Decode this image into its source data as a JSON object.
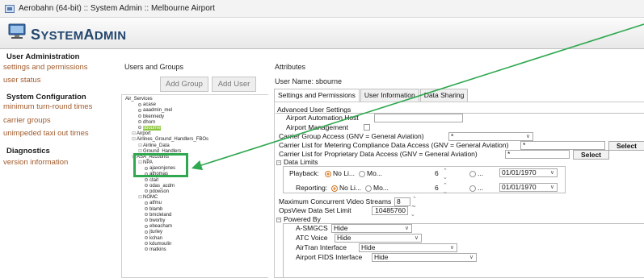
{
  "window": {
    "title": "Aerobahn (64-bit) :: System Admin :: Melbourne Airport"
  },
  "banner": {
    "brand_prefix": "S",
    "brand_main": "YSTEM",
    "brand_prefix2": "A",
    "brand_main2": "DMIN"
  },
  "nav": {
    "sections": [
      {
        "heading": "User Administration",
        "links": [
          "settings and permissions",
          "user status"
        ]
      },
      {
        "heading": "System Configuration",
        "links": [
          "minimum turn-round times",
          "carrier groups",
          "unimpeded taxi out times"
        ]
      },
      {
        "heading": "Diagnostics",
        "links": [
          "version information"
        ]
      }
    ]
  },
  "users_groups": {
    "title": "Users and Groups",
    "add_group": "Add Group",
    "add_user": "Add User",
    "tree": [
      {
        "label": "Air_Services",
        "indent": 0,
        "type": "group"
      },
      {
        "label": "acase",
        "indent": 2,
        "type": "user"
      },
      {
        "label": "aaadmin_mel",
        "indent": 2,
        "type": "user"
      },
      {
        "label": "bkennedy",
        "indent": 2,
        "type": "user"
      },
      {
        "label": "dhorn",
        "indent": 2,
        "type": "user"
      },
      {
        "label": "sbourne",
        "indent": 2,
        "type": "user",
        "selected": true
      },
      {
        "label": "Airport",
        "indent": 1,
        "type": "group"
      },
      {
        "label": "Airlines_Ground_Handlers_FBOs",
        "indent": 1,
        "type": "group"
      },
      {
        "label": "Airline_Data",
        "indent": 2,
        "type": "group"
      },
      {
        "label": "Ground_Handlers",
        "indent": 2,
        "type": "group"
      },
      {
        "label": "ASA_Accounts",
        "indent": 1,
        "type": "group"
      },
      {
        "label": "NPA",
        "indent": 2,
        "type": "group"
      },
      {
        "label": "ajaxonjones",
        "indent": 3,
        "type": "user"
      },
      {
        "label": "athomas",
        "indent": 3,
        "type": "user"
      },
      {
        "label": "ctait",
        "indent": 3,
        "type": "user"
      },
      {
        "label": "odas_acdm",
        "indent": 3,
        "type": "user"
      },
      {
        "label": "pdowson",
        "indent": 3,
        "type": "user"
      },
      {
        "label": "NOMC",
        "indent": 2,
        "type": "group"
      },
      {
        "label": "atfmu",
        "indent": 3,
        "type": "user"
      },
      {
        "label": "blamb",
        "indent": 3,
        "type": "user"
      },
      {
        "label": "bmcleland",
        "indent": 3,
        "type": "user"
      },
      {
        "label": "bworby",
        "indent": 3,
        "type": "user"
      },
      {
        "label": "ebeacham",
        "indent": 3,
        "type": "user"
      },
      {
        "label": "jturley",
        "indent": 3,
        "type": "user"
      },
      {
        "label": "kchan",
        "indent": 3,
        "type": "user"
      },
      {
        "label": "kdumoulin",
        "indent": 3,
        "type": "user"
      },
      {
        "label": "matkins",
        "indent": 3,
        "type": "user"
      }
    ]
  },
  "attributes": {
    "title": "Attributes",
    "user_name": "User Name: sbourne",
    "tabs": [
      "Settings and Permissions",
      "User Information",
      "Data Sharing"
    ],
    "advanced_heading": "Advanced User Settings",
    "host_label": "Airport Automation Host",
    "mgmt_label": "Airport Management",
    "carrier_group_label": "Carrier Group Access (GNV = General Aviation)",
    "carrier_group_value": "*",
    "metering_label": "Carrier List for Metering Compliance Data Access (GNV = General Aviation)",
    "metering_value": "*",
    "proprietary_label": "Carrier List for Proprietary Data Access (GNV = General Aviation)",
    "proprietary_value": "*",
    "select_label": "Select",
    "data_limits": "Data Limits",
    "playback_label": "Playback:",
    "reporting_label": "Reporting:",
    "no_limit": "No Li...",
    "months": "Mo...",
    "months_value": "6",
    "ellipsis": "...",
    "date_value": "01/01/1970",
    "max_streams_label": "Maximum Concurrent Video Streams",
    "max_streams_value": "8",
    "opsview_label": "OpsView Data Set Limit",
    "opsview_value": "10485760",
    "powered_by": "Powered By",
    "asmgcs_label": "A-SMGCS",
    "atc_label": "ATC Voice",
    "airtran_label": "AirTran Interface",
    "fids_label": "Airport FIDS Interface",
    "hide": "Hide"
  }
}
